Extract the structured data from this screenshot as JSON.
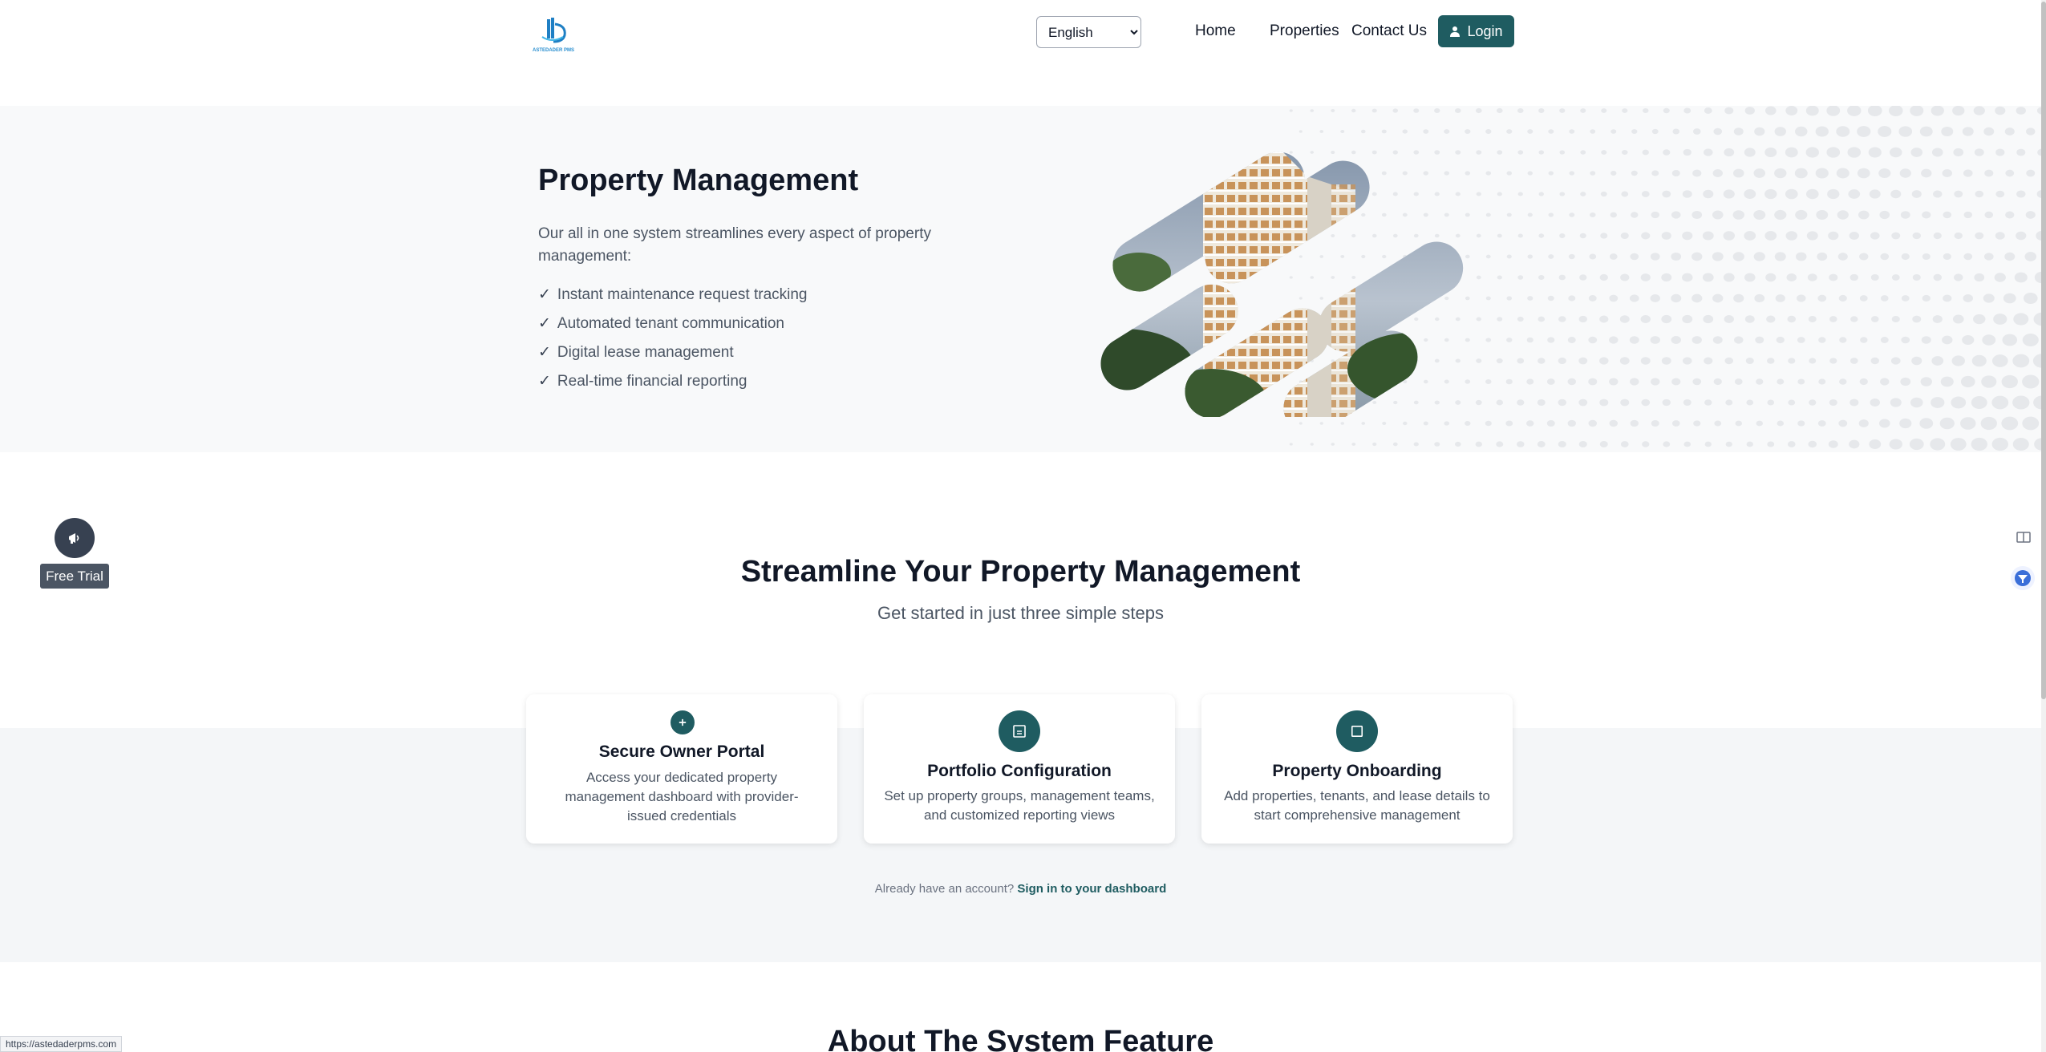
{
  "header": {
    "logo_text": "ASTEDADER PMS",
    "language": {
      "selected": "English",
      "options": [
        "English"
      ]
    },
    "nav": {
      "home": "Home",
      "properties": "Properties",
      "contact": "Contact Us"
    },
    "login_label": "Login"
  },
  "hero": {
    "title": "Property Management",
    "description": "Our all in one system streamlines every aspect of property management:",
    "features": [
      "Instant maintenance request tracking",
      "Automated tenant communication",
      "Digital lease management",
      "Real-time financial reporting"
    ],
    "check_symbol": "✓"
  },
  "free_trial": {
    "label": "Free Trial",
    "icon": "megaphone-icon"
  },
  "steps": {
    "title": "Streamline Your Property Management",
    "subtitle": "Get started in just three simple steps",
    "cards": [
      {
        "title": "Secure Owner Portal",
        "description": "Access your dedicated property management dashboard with provider-issued credentials",
        "icon": "plus-icon"
      },
      {
        "title": "Portfolio Configuration",
        "description": "Set up property groups, management teams, and customized reporting views",
        "icon": "document-icon"
      },
      {
        "title": "Property Onboarding",
        "description": "Add properties, tenants, and lease details to start comprehensive management",
        "icon": "square-icon"
      }
    ],
    "account_prompt": "Already have an account?",
    "signin_label": "Sign in to your dashboard"
  },
  "about": {
    "title": "About The System Feature"
  },
  "status_bar": {
    "url": "https://astedaderpms.com"
  },
  "colors": {
    "brand": "#1f5c61",
    "hero_bg": "#f8f9fa",
    "band_bg": "#f4f6f8"
  }
}
